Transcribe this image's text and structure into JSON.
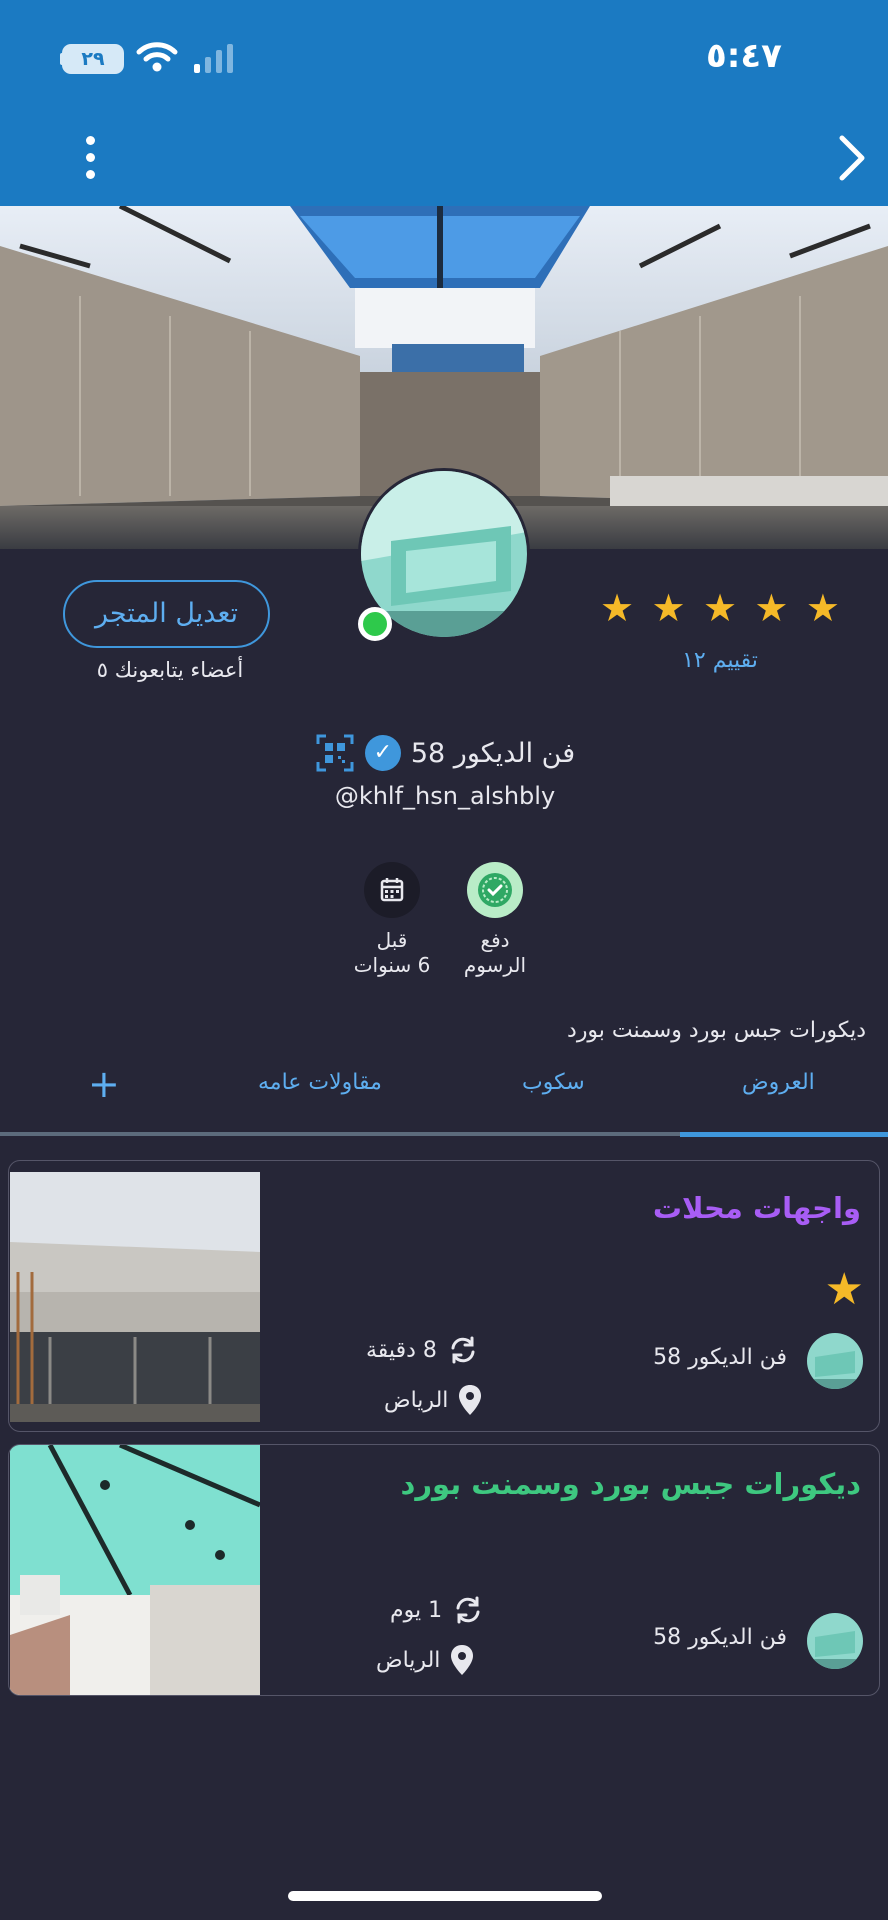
{
  "status_bar": {
    "time": "٥:٤٧",
    "battery": "٢٩"
  },
  "store": {
    "name": "فن الديكور 58",
    "handle": "@khlf_hsn_alshbly",
    "edit_button": "تعديل المتجر",
    "followers_label": "أعضاء يتابعونك ٥",
    "rating_label": "تقييم ١٢",
    "stars": 5,
    "description": "ديكورات جبس بورد وسمنت بورد"
  },
  "badges": [
    {
      "icon": "seal-check-icon",
      "label_line1": "دفع",
      "label_line2": "الرسوم",
      "color": "#b9ecc7"
    },
    {
      "icon": "calendar-icon",
      "label_line1": "قبل",
      "label_line2": "6 سنوات",
      "color": "#1c1c28"
    }
  ],
  "tabs": {
    "items": [
      "العروض",
      "سكوب",
      "مقاولات عامه"
    ],
    "active": "العروض",
    "add_icon": "plus-icon"
  },
  "listings": [
    {
      "title": "واجهات محلات",
      "title_color": "#a85df5",
      "starred": true,
      "owner": "فن الديكور 58",
      "time": "8 دقيقة",
      "city": "الرياض"
    },
    {
      "title": "ديكورات جبس بورد وسمنت بورد",
      "title_color": "#3ec880",
      "starred": false,
      "owner": "فن الديكور 58",
      "time": "1 يوم",
      "city": "الرياض"
    }
  ],
  "colors": {
    "header": "#1b7ac2",
    "accent": "#3f97dc",
    "background": "#262637",
    "star": "#f5b928"
  }
}
